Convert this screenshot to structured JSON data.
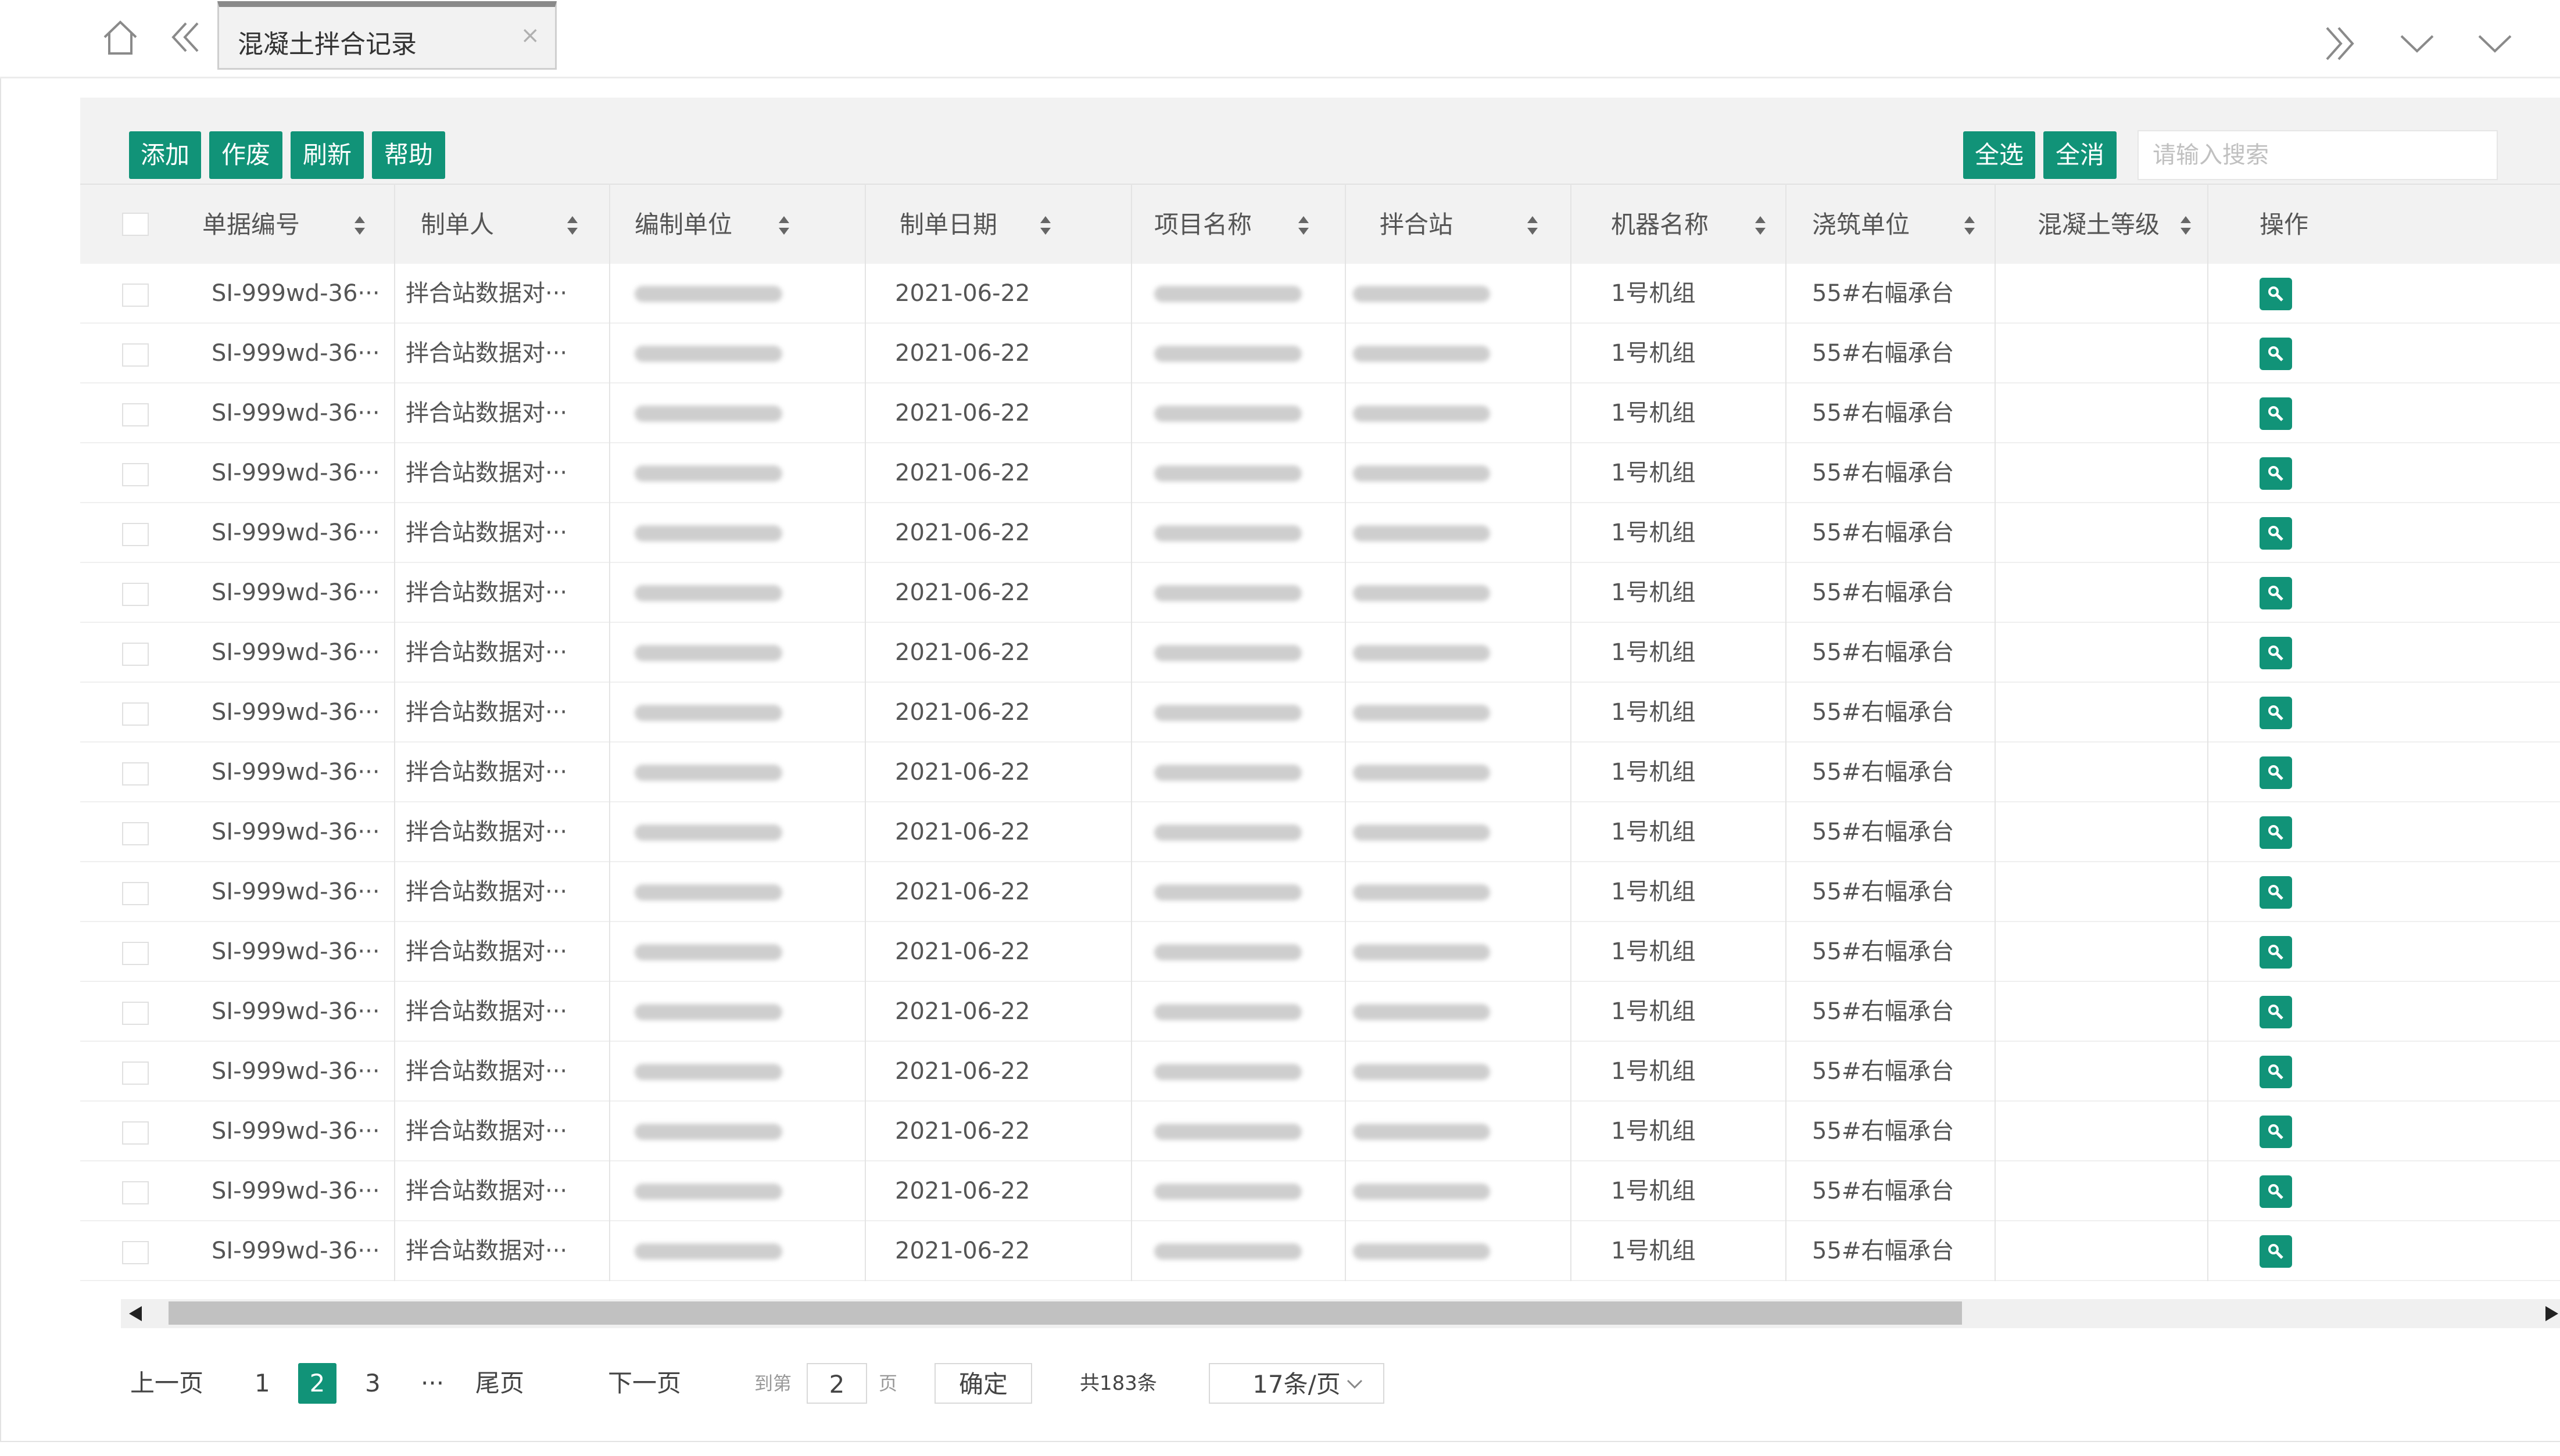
{
  "tabbar": {
    "tab_title": "混凝土拌合记录",
    "close_glyph": "×"
  },
  "toolbar": {
    "add": "添加",
    "void": "作废",
    "refresh": "刷新",
    "help": "帮助",
    "select_all": "全选",
    "deselect_all": "全消",
    "search_placeholder": "请输入搜索"
  },
  "table": {
    "columns": [
      "单据编号",
      "制单人",
      "编制单位",
      "制单日期",
      "项目名称",
      "拌合站",
      "机器名称",
      "浇筑单位",
      "混凝土等级",
      "操作"
    ],
    "rows": [
      {
        "doc_no": "SI-999wd-36···",
        "creator": "拌合站数据对···",
        "date": "2021-06-22",
        "machine": "1号机组",
        "pour_unit": "55#右幅承台"
      },
      {
        "doc_no": "SI-999wd-36···",
        "creator": "拌合站数据对···",
        "date": "2021-06-22",
        "machine": "1号机组",
        "pour_unit": "55#右幅承台"
      },
      {
        "doc_no": "SI-999wd-36···",
        "creator": "拌合站数据对···",
        "date": "2021-06-22",
        "machine": "1号机组",
        "pour_unit": "55#右幅承台"
      },
      {
        "doc_no": "SI-999wd-36···",
        "creator": "拌合站数据对···",
        "date": "2021-06-22",
        "machine": "1号机组",
        "pour_unit": "55#右幅承台"
      },
      {
        "doc_no": "SI-999wd-36···",
        "creator": "拌合站数据对···",
        "date": "2021-06-22",
        "machine": "1号机组",
        "pour_unit": "55#右幅承台"
      },
      {
        "doc_no": "SI-999wd-36···",
        "creator": "拌合站数据对···",
        "date": "2021-06-22",
        "machine": "1号机组",
        "pour_unit": "55#右幅承台"
      },
      {
        "doc_no": "SI-999wd-36···",
        "creator": "拌合站数据对···",
        "date": "2021-06-22",
        "machine": "1号机组",
        "pour_unit": "55#右幅承台"
      },
      {
        "doc_no": "SI-999wd-36···",
        "creator": "拌合站数据对···",
        "date": "2021-06-22",
        "machine": "1号机组",
        "pour_unit": "55#右幅承台"
      },
      {
        "doc_no": "SI-999wd-36···",
        "creator": "拌合站数据对···",
        "date": "2021-06-22",
        "machine": "1号机组",
        "pour_unit": "55#右幅承台"
      },
      {
        "doc_no": "SI-999wd-36···",
        "creator": "拌合站数据对···",
        "date": "2021-06-22",
        "machine": "1号机组",
        "pour_unit": "55#右幅承台"
      },
      {
        "doc_no": "SI-999wd-36···",
        "creator": "拌合站数据对···",
        "date": "2021-06-22",
        "machine": "1号机组",
        "pour_unit": "55#右幅承台"
      },
      {
        "doc_no": "SI-999wd-36···",
        "creator": "拌合站数据对···",
        "date": "2021-06-22",
        "machine": "1号机组",
        "pour_unit": "55#右幅承台"
      },
      {
        "doc_no": "SI-999wd-36···",
        "creator": "拌合站数据对···",
        "date": "2021-06-22",
        "machine": "1号机组",
        "pour_unit": "55#右幅承台"
      },
      {
        "doc_no": "SI-999wd-36···",
        "creator": "拌合站数据对···",
        "date": "2021-06-22",
        "machine": "1号机组",
        "pour_unit": "55#右幅承台"
      },
      {
        "doc_no": "SI-999wd-36···",
        "creator": "拌合站数据对···",
        "date": "2021-06-22",
        "machine": "1号机组",
        "pour_unit": "55#右幅承台"
      },
      {
        "doc_no": "SI-999wd-36···",
        "creator": "拌合站数据对···",
        "date": "2021-06-22",
        "machine": "1号机组",
        "pour_unit": "55#右幅承台"
      },
      {
        "doc_no": "SI-999wd-36···",
        "creator": "拌合站数据对···",
        "date": "2021-06-22",
        "machine": "1号机组",
        "pour_unit": "55#右幅承台"
      }
    ]
  },
  "pager": {
    "prev": "上一页",
    "pages": [
      "1",
      "2",
      "3"
    ],
    "current": "2",
    "ellipsis": "···",
    "last": "尾页",
    "next": "下一页",
    "goto_label": "到第",
    "goto_value": "2",
    "page_unit": "页",
    "confirm": "确定",
    "total": "共183条",
    "page_size": "17条/页"
  },
  "colors": {
    "accent": "#119378",
    "header_bg": "#f2f2f2"
  },
  "icons": [
    "home-icon",
    "double-chevron-left-icon",
    "double-chevron-right-icon",
    "chevron-down-icon",
    "sort-icon",
    "search-icon"
  ]
}
